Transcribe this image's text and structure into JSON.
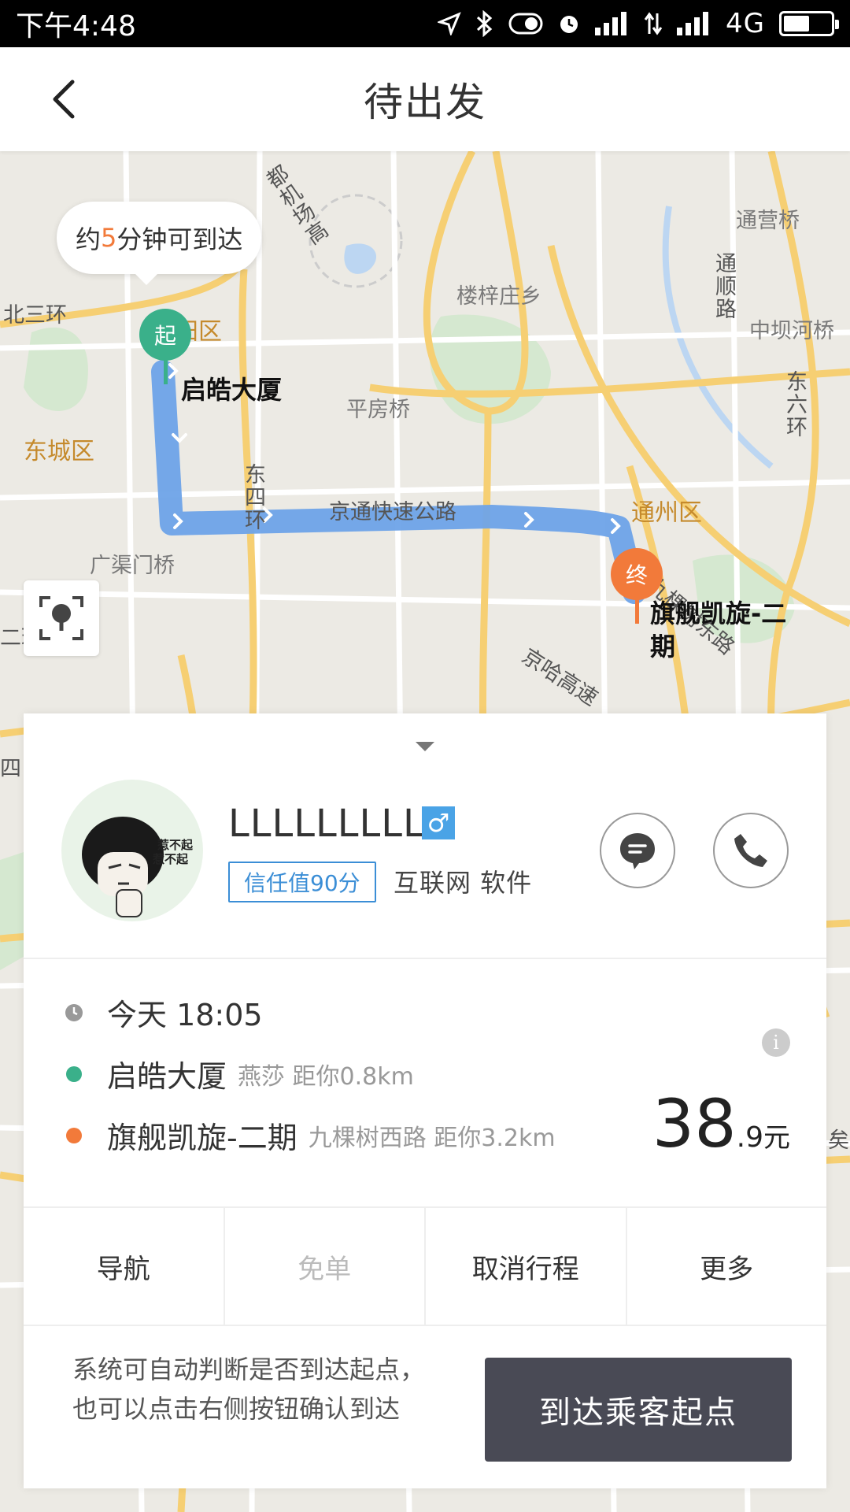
{
  "status_bar": {
    "time": "下午4:48",
    "network": "4G",
    "icons": [
      "location-arrow-icon",
      "bluetooth-icon",
      "toggle-icon",
      "alarm-icon",
      "signal-icon",
      "data-transfer-icon",
      "signal-icon",
      "battery-icon"
    ],
    "battery_level": 0.55
  },
  "header": {
    "title": "待出发",
    "back_icon": "chevron-left-icon"
  },
  "map": {
    "eta_prefix": "约",
    "eta_minutes": "5",
    "eta_suffix": "分钟可到达",
    "start_pin_label": "起",
    "end_pin_label": "终",
    "start_place": "启皓大厦",
    "end_place_line1": "旗舰凯旋-二",
    "end_place_line2": "期",
    "labels": {
      "airport_expressway": "都机场高",
      "tongying_bridge": "通营桥",
      "north_third_ring": "北三环",
      "chaoyang_district": "阳区",
      "louzizhuang": "楼梓庄乡",
      "tongshun_road": "通顺路",
      "zhongbahe_bridge": "中坝河桥",
      "east_sixth_ring": "东六环",
      "pingfang_bridge": "平房桥",
      "dongcheng_district": "东城区",
      "east_fourth_ring": "东四环",
      "jingtong_expressway": "京通快速公路",
      "tongzhou_district": "通州区",
      "guangqumen_bridge": "广渠门桥",
      "jiukeshu_road": "九棵树东路",
      "jingha_expressway": "京哈高速",
      "second_ring_fragment": "二环",
      "left_edge_fragment": "四",
      "right_edge_fragment": "矣"
    },
    "colors": {
      "route": "#6ea3e8",
      "major_road": "#f6cf73",
      "minor_road": "#ffffff",
      "green": "#d3e9cf",
      "start": "#3ab08a",
      "end": "#f27a3a"
    }
  },
  "passenger": {
    "name": "LLLLLLLLL",
    "gender_icon": "male-icon",
    "gender_symbol": "♂",
    "trust_score": "信任值90分",
    "tags": "互联网 软件",
    "avatar_text": "惹不起 惹不起",
    "message_icon": "chat-bubble-icon",
    "call_icon": "phone-icon"
  },
  "trip": {
    "time": "今天 18:05",
    "start_name": "启皓大厦",
    "start_detail": "燕莎 距你0.8km",
    "end_name": "旗舰凯旋-二期",
    "end_detail": "九棵树西路 距你3.2km",
    "price_integer": "38",
    "price_decimal": ".9",
    "price_unit": "元",
    "info_icon": "i"
  },
  "actions": {
    "navigate": "导航",
    "free_order": "免单",
    "cancel_trip": "取消行程",
    "more": "更多"
  },
  "bottom": {
    "hint": "系统可自动判断是否到达起点，也可以点击右侧按钮确认到达",
    "arrive_button": "到达乘客起点"
  }
}
